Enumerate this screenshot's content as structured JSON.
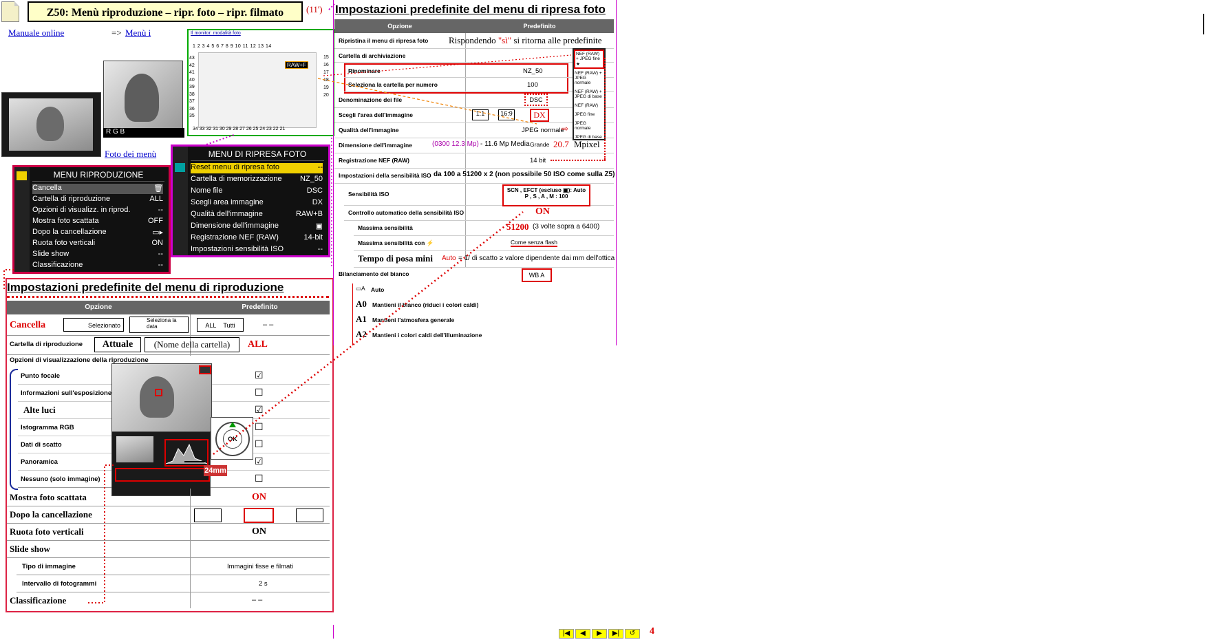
{
  "header": {
    "title": "Z50: Menù riproduzione – ripr. foto – ripr. filmato",
    "page_ref": "(11')",
    "manual_link": "Manuale online",
    "menu_prefix": "=>",
    "menu_link": "Menù i",
    "photo_link": "Foto dei menù"
  },
  "monitor": {
    "caption": "Il monitor: modalità foto",
    "top_numbers": "1 2 3 4 5 6  7 8 9  10  11  12 13 14",
    "left_numbers": [
      "43",
      "42",
      "41",
      "40",
      "39",
      "38",
      "37",
      "36",
      "35"
    ],
    "right_numbers": [
      "15",
      "16",
      "17",
      "18",
      "19",
      "20"
    ],
    "bottom_numbers": "34 33 32  31  30 29 28 27 26 25 24  23 22 21",
    "raw_badge": "RAW+F"
  },
  "playback_menu": {
    "title": "MENU RIPRODUZIONE",
    "items": [
      {
        "label": "Cancella",
        "value": "🗑"
      },
      {
        "label": "Cartella di riproduzione",
        "value": "ALL"
      },
      {
        "label": "Opzioni di visualizz. in riprod.",
        "value": "--"
      },
      {
        "label": "Mostra foto scattata",
        "value": "OFF"
      },
      {
        "label": "Dopo la cancellazione",
        "value": "▭▸"
      },
      {
        "label": "Ruota foto verticali",
        "value": "ON"
      },
      {
        "label": "Slide show",
        "value": "--"
      },
      {
        "label": "Classificazione",
        "value": "--"
      }
    ]
  },
  "shooting_menu": {
    "title": "MENU DI RIPRESA FOTO",
    "items": [
      {
        "label": "Reset menu di ripresa foto",
        "value": "--"
      },
      {
        "label": "Cartella di memorizzazione",
        "value": "NZ_50"
      },
      {
        "label": "Nome file",
        "value": "DSC"
      },
      {
        "label": "Scegli area immagine",
        "value": "DX"
      },
      {
        "label": "Qualità dell'immagine",
        "value": "RAW+B"
      },
      {
        "label": "Dimensione dell'immagine",
        "value": "▣"
      },
      {
        "label": "Registrazione NEF (RAW)",
        "value": "14-bit"
      },
      {
        "label": "Impostazioni sensibilità ISO",
        "value": "--"
      }
    ]
  },
  "playback_defaults": {
    "heading": "Impostazioni predefinite del menu di riproduzione",
    "col_option": "Opzione",
    "col_default": "Predefinito",
    "cancella": {
      "label": "Cancella",
      "opt1": "Selezionato",
      "opt2": "Seleziona la data",
      "opt3": "Tutti",
      "opt3_icon": "ALL",
      "default": "– –"
    },
    "cartella": {
      "label": "Cartella di riproduzione",
      "opt1": "Attuale",
      "opt2": "(Nome della cartella)",
      "default": "ALL"
    },
    "opzioni_heading": "Opzioni di visualizzazione della riproduzione",
    "opzioni": [
      {
        "label": "Punto focale",
        "check": "☑"
      },
      {
        "label": "Informazioni sull'esposizione",
        "check": "☐"
      },
      {
        "label": "Alte luci",
        "check": "☑"
      },
      {
        "label": "Istogramma RGB",
        "check": "☐"
      },
      {
        "label": "Dati di scatto",
        "check": "☐"
      },
      {
        "label": "Panoramica",
        "check": "☑"
      },
      {
        "label": "Nessuno (solo immagine)",
        "check": "☐"
      }
    ],
    "mostra": {
      "label": "Mostra foto scattata",
      "default": "ON"
    },
    "dopo": {
      "label": "Dopo la cancellazione"
    },
    "ruota": {
      "label": "Ruota foto verticali",
      "default": "ON"
    },
    "slide": {
      "label": "Slide show"
    },
    "tipo": {
      "label": "Tipo di immagine",
      "default": "Immagini fisse e filmati"
    },
    "intervallo": {
      "label": "Intervallo di fotogrammi",
      "default": "2 s"
    },
    "classificazione": {
      "label": "Classificazione",
      "default": "– –"
    },
    "lens_label": "24mm",
    "ok_label": "OK"
  },
  "shooting_defaults": {
    "heading": "Impostazioni predefinite del menu di ripresa foto",
    "col_option": "Opzione",
    "col_default": "Predefinito",
    "rows": {
      "ripristina": {
        "label": "Ripristina il menu di ripresa foto",
        "default_prefix": "Rispondendo",
        "default_si": "\"sì\"",
        "default_suffix": "si ritorna alle predefinite"
      },
      "cartella": {
        "label": "Cartella di archiviazione"
      },
      "rinominare": {
        "label": "Rinominare",
        "default": "NZ_50"
      },
      "seleziona": {
        "label": "Seleziona la cartella per numero",
        "default": "100"
      },
      "denominazione": {
        "label": "Denominazione dei file",
        "default": "DSC"
      },
      "area": {
        "label": "Scegli l'area dell'immagine",
        "opt1": "1:1",
        "opt2": "16:9",
        "default": "DX"
      },
      "qualita": {
        "label": "Qualità dell'immagine",
        "default": "JPEG normale"
      },
      "dimensione": {
        "label": "Dimensione dell'immagine",
        "mp": "(0300 12.3 Mp)",
        "media": "- 11.6 Mp Media",
        "grande": "Grande",
        "value": "20.7",
        "unit": "Mpixel"
      },
      "nef": {
        "label": "Registrazione NEF (RAW)",
        "default": "14 bit"
      },
      "iso_imp": {
        "label": "Impostazioni della sensibilità ISO",
        "default": "da 100 a 51200 x 2 (non possibile 50 ISO come sulla Z5)"
      },
      "iso": {
        "label": "Sensibilità ISO",
        "line1": "SCN , EFCT (escluso ▣): Auto",
        "line2": "P , S , A , M : 100"
      },
      "auto": {
        "label": "Controllo automatico della sensibilità ISO",
        "default": "ON"
      },
      "massima": {
        "label": "Massima sensibilità",
        "value": "51200",
        "note": "(3 volte sopra a 6400)"
      },
      "flash": {
        "label": "Massima sensibilità con ⚡",
        "default": "Come senza flash"
      },
      "tempo": {
        "label": "Tempo di posa mini",
        "auto": "Auto",
        "rest": "= 1/ di scatto ≥ valore dipendente dai mm dell'ottica"
      },
      "bil": {
        "label": "Bilanciamento del bianco",
        "icon": "WB A"
      },
      "wb_auto": {
        "label": "Auto"
      },
      "a0": {
        "sym": "A0",
        "label": "Mantieni il bianco (riduci i colori caldi)"
      },
      "a1": {
        "sym": "A1",
        "label": "Mantieni l'atmosfera generale"
      },
      "a2": {
        "sym": "A2",
        "label": "Mantieni i colori caldi dell'illuminazione"
      }
    },
    "quality_list": [
      "NEF (RAW) + JPEG fine ★",
      "NEF (RAW) + JPEG normale",
      "NEF (RAW) + JPEG di base",
      "NEF (RAW)",
      "JPEG fine",
      "JPEG normale",
      "JPEG di base"
    ]
  },
  "footer": {
    "nav": [
      "|◀",
      "◀",
      "▶",
      "▶|",
      "↺"
    ],
    "page_number": "4"
  }
}
